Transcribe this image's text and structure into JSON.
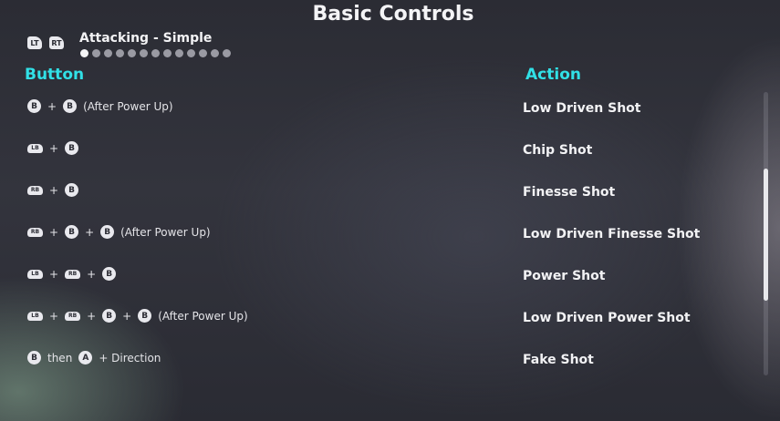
{
  "title": "Basic Controls",
  "nav": {
    "left_trigger": "LT",
    "right_trigger": "RT",
    "subtitle": "Attacking - Simple",
    "page_count": 13,
    "active_page": 1
  },
  "columns": {
    "button": "Button",
    "action": "Action"
  },
  "rows": [
    {
      "inputs": [
        {
          "type": "round",
          "label": "B"
        },
        {
          "type": "plus",
          "label": "+"
        },
        {
          "type": "round",
          "label": "B"
        },
        {
          "type": "note",
          "label": "(After Power Up)"
        }
      ],
      "action": "Low Driven Shot"
    },
    {
      "inputs": [
        {
          "type": "bumper",
          "label": "LB"
        },
        {
          "type": "plus",
          "label": "+"
        },
        {
          "type": "round",
          "label": "B"
        }
      ],
      "action": "Chip Shot"
    },
    {
      "inputs": [
        {
          "type": "bumper",
          "label": "RB"
        },
        {
          "type": "plus",
          "label": "+"
        },
        {
          "type": "round",
          "label": "B"
        }
      ],
      "action": "Finesse Shot"
    },
    {
      "inputs": [
        {
          "type": "bumper",
          "label": "RB"
        },
        {
          "type": "plus",
          "label": "+"
        },
        {
          "type": "round",
          "label": "B"
        },
        {
          "type": "plus",
          "label": "+"
        },
        {
          "type": "round",
          "label": "B"
        },
        {
          "type": "note",
          "label": "(After Power Up)"
        }
      ],
      "action": "Low Driven Finesse Shot"
    },
    {
      "inputs": [
        {
          "type": "bumper",
          "label": "LB"
        },
        {
          "type": "plus",
          "label": "+"
        },
        {
          "type": "bumper",
          "label": "RB"
        },
        {
          "type": "plus",
          "label": "+"
        },
        {
          "type": "round",
          "label": "B"
        }
      ],
      "action": "Power Shot"
    },
    {
      "inputs": [
        {
          "type": "bumper",
          "label": "LB"
        },
        {
          "type": "plus",
          "label": "+"
        },
        {
          "type": "bumper",
          "label": "RB"
        },
        {
          "type": "plus",
          "label": "+"
        },
        {
          "type": "round",
          "label": "B"
        },
        {
          "type": "plus",
          "label": "+"
        },
        {
          "type": "round",
          "label": "B"
        },
        {
          "type": "note",
          "label": "(After Power Up)"
        }
      ],
      "action": "Low Driven Power Shot"
    },
    {
      "inputs": [
        {
          "type": "round",
          "label": "B"
        },
        {
          "type": "note",
          "label": "then"
        },
        {
          "type": "round",
          "label": "A"
        },
        {
          "type": "note",
          "label": "+ Direction"
        }
      ],
      "action": "Fake Shot"
    }
  ],
  "scroll_position": 0.27,
  "colors": {
    "header_accent": "#31e0e6",
    "text": "#f2f2f4",
    "button_glyph": "#e9e9ee"
  }
}
